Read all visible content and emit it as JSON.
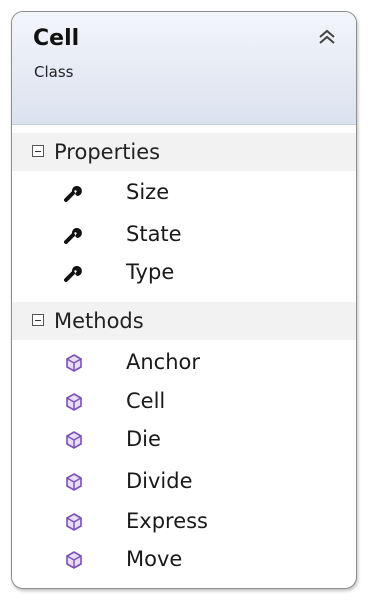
{
  "class": {
    "name": "Cell",
    "stereotype": "Class"
  },
  "sections": {
    "properties": {
      "label": "Properties",
      "items": [
        "Size",
        "State",
        "Type"
      ],
      "icon": "wrench-icon"
    },
    "methods": {
      "label": "Methods",
      "items": [
        "Anchor",
        "Cell",
        "Die",
        "Divide",
        "Express",
        "Move"
      ],
      "icon": "method-cube-icon"
    }
  },
  "colors": {
    "header_gradient_top": "#f3f5fa",
    "header_gradient_bottom": "#dbe2ef",
    "method_icon": "#7a4fb8",
    "border": "#8e8e8e"
  }
}
